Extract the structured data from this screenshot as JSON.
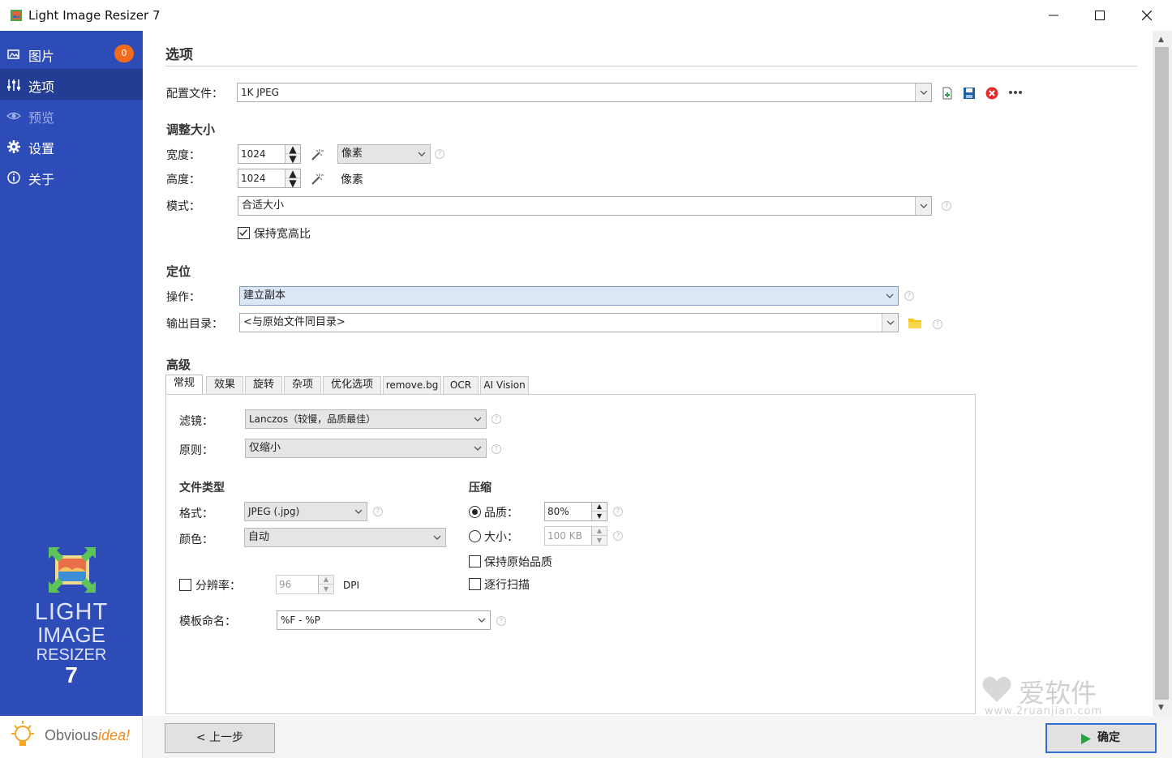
{
  "window": {
    "title": "Light Image Resizer 7"
  },
  "sidebar": {
    "items": [
      {
        "label": "图片",
        "badge": "0",
        "icon": "images-icon"
      },
      {
        "label": "选项",
        "icon": "sliders-icon"
      },
      {
        "label": "预览",
        "icon": "eye-icon"
      },
      {
        "label": "设置",
        "icon": "gear-icon"
      },
      {
        "label": "关于",
        "icon": "info-icon"
      }
    ],
    "logo": {
      "line1": "LIGHT",
      "line2": "IMAGE",
      "line3": "RESIZER",
      "line4": "7"
    },
    "brand": {
      "prefix": "Obvious",
      "accent": "idea!"
    }
  },
  "page": {
    "title": "选项"
  },
  "profile": {
    "label": "配置文件：",
    "value": "1K JPEG"
  },
  "resize": {
    "title": "调整大小",
    "width_label": "宽度：",
    "width_value": "1024",
    "height_label": "高度：",
    "height_value": "1024",
    "unit_value": "像素",
    "height_unit": "像素",
    "mode_label": "模式：",
    "mode_value": "合适大小",
    "keep_ratio_label": "保持宽高比",
    "keep_ratio": true
  },
  "target": {
    "title": "定位",
    "action_label": "操作：",
    "action_value": "建立副本",
    "output_label": "输出目录：",
    "output_value": "<与原始文件同目录>"
  },
  "advanced": {
    "title": "高级",
    "tabs": [
      "常规",
      "效果",
      "旋转",
      "杂项",
      "优化选项",
      "remove.bg",
      "OCR",
      "AI Vision"
    ],
    "active_tab": "常规",
    "filter_label": "滤镜：",
    "filter_value": "Lanczos（较慢，品质最佳）",
    "rule_label": "原则：",
    "rule_value": "仅缩小",
    "filetype_title": "文件类型",
    "format_label": "格式：",
    "format_value": "JPEG (.jpg)",
    "color_label": "颜色：",
    "color_value": "自动",
    "resolution_label": "分辨率：",
    "resolution_value": "96",
    "resolution_unit": "DPI",
    "template_label": "模板命名：",
    "template_value": "%F - %P",
    "compression_title": "压缩",
    "quality_label": "品质：",
    "quality_value": "80%",
    "size_label": "大小：",
    "size_value": "100 KB",
    "keep_quality_label": "保持原始品质",
    "progressive_label": "逐行扫描"
  },
  "footer": {
    "back_label": "< 上一步",
    "ok_label": "确定"
  },
  "watermark": {
    "line1": "爱软件",
    "line2": "www.2ruanjian.com"
  },
  "colors": {
    "sidebar": "#2e4cb8",
    "sidebar_active": "#233c94",
    "badge": "#f26a1b",
    "ok_icon": "#22a53b"
  }
}
